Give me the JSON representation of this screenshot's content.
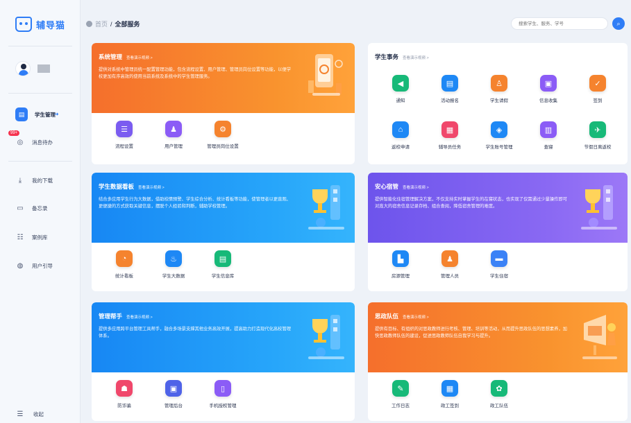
{
  "app": {
    "name": "辅导猫"
  },
  "colors": {
    "accent": "#2f7df6",
    "orange": "#f5832e",
    "blue": "#1f97f7",
    "purple": "#7b5ef0",
    "badge": "#f5334f"
  },
  "sidebar": {
    "items": [
      {
        "label": "学生管理",
        "icon": "student-icon",
        "active": true
      },
      {
        "label": "消息待办",
        "icon": "message-icon",
        "badge": "99+"
      },
      {
        "label": "我的下载",
        "icon": "download-icon"
      },
      {
        "label": "备忘录",
        "icon": "memo-icon"
      },
      {
        "label": "案例库",
        "icon": "case-library-icon"
      },
      {
        "label": "用户引导",
        "icon": "guide-icon"
      }
    ],
    "collapse_label": "收起"
  },
  "header": {
    "breadcrumb_home": "首页",
    "breadcrumb_sep": "/",
    "breadcrumb_current": "全部服务",
    "search_placeholder": "搜索学生、服务、学号"
  },
  "cards": {
    "system": {
      "title": "系统管理",
      "link": "查看演示视频 >",
      "desc_lines": [
        "提供对系统中管理员统一配置管理功能，包含流程设置、用户管理、管理员岗位设置等功能，以便学",
        "校更加有序高效的使用当前系统及系统中的学生管理服务。"
      ],
      "tiles": [
        {
          "label": "流程设置",
          "icon": "workflow-icon",
          "color": "#7a5cf0"
        },
        {
          "label": "用户管理",
          "icon": "users-icon",
          "color": "#8b5cf6"
        },
        {
          "label": "管理员岗位设置",
          "icon": "admin-post-icon",
          "color": "#f5832e"
        }
      ]
    },
    "student_affairs": {
      "title": "学生事务",
      "link": "查看演示视频 >",
      "tiles": [
        {
          "label": "通知",
          "icon": "speaker-icon",
          "color": "#17b978"
        },
        {
          "label": "活动报名",
          "icon": "signup-icon",
          "color": "#1e88f5"
        },
        {
          "label": "学生请假",
          "icon": "leave-icon",
          "color": "#f5832e"
        },
        {
          "label": "信息收集",
          "icon": "collect-icon",
          "color": "#8b5cf6"
        },
        {
          "label": "签到",
          "icon": "checkin-icon",
          "color": "#f5832e"
        },
        {
          "label": "返校申请",
          "icon": "return-icon",
          "color": "#1e88f5"
        },
        {
          "label": "辅导员任务",
          "icon": "task-icon",
          "color": "#f0476b"
        },
        {
          "label": "学生账号管理",
          "icon": "account-icon",
          "color": "#1e88f5"
        },
        {
          "label": "查寝",
          "icon": "dorm-check-icon",
          "color": "#8b5cf6"
        },
        {
          "label": "节假日离返校",
          "icon": "holiday-icon",
          "color": "#17b978"
        }
      ]
    },
    "data_board": {
      "title": "学生数据看板",
      "link": "查看演示视频 >",
      "desc_lines": [
        "结合多应用学生行为大数据，借助校情预警、学生综合分析、统计看板等功能，使管理者以更直观、",
        "更便捷的方式获取关键信息，摆脱个人经验和判断，辅助学校管理。"
      ],
      "tiles": [
        {
          "label": "统计看板",
          "icon": "stats-icon",
          "color": "#f5832e"
        },
        {
          "label": "学生大数据",
          "icon": "bigdata-icon",
          "color": "#1e88f5"
        },
        {
          "label": "学生信息库",
          "icon": "info-db-icon",
          "color": "#17b978"
        }
      ]
    },
    "dorm": {
      "title": "安心宿管",
      "link": "查看演示视频 >",
      "desc_lines": [
        "提供智能化住宿管理解决方案，不仅支持实时掌握学生的在寝状态，也实现了仅需通过少量操作即可",
        "对庞大的宿舍信息记录存档、组合查阅，降低宿舍管理的难度。"
      ],
      "tiles": [
        {
          "label": "房源管理",
          "icon": "room-icon",
          "color": "#1e88f5"
        },
        {
          "label": "管理人员",
          "icon": "staff-icon",
          "color": "#f5832e"
        },
        {
          "label": "学生住宿",
          "icon": "bed-icon",
          "color": "#3b82f6"
        }
      ]
    },
    "assistant": {
      "title": "管理帮手",
      "link": "查看演示视频 >",
      "desc_lines": [
        "提供多应用跨平台管理工具帮手，融合多场景支撑其他业务高效开展，提高助力打造现代化高校管理",
        "体系。"
      ],
      "tiles": [
        {
          "label": "防诈骗",
          "icon": "anti-fraud-icon",
          "color": "#f0476b"
        },
        {
          "label": "管理后台",
          "icon": "backend-icon",
          "color": "#4f63e8"
        },
        {
          "label": "手机授权管理",
          "icon": "phone-auth-icon",
          "color": "#8b5cf6"
        }
      ]
    },
    "team": {
      "title": "思政队伍",
      "link": "查看演示视频 >",
      "desc_lines": [
        "提供有目标、有组织的对思政教师进行考核、管理、培训等活动，从而提升思政队伍的思想素养，加",
        "快思政教师队伍的建设，促进思政教师队伍自我学习与提升。"
      ],
      "tiles": [
        {
          "label": "工作日志",
          "icon": "worklog-icon",
          "color": "#17b978"
        },
        {
          "label": "政工签到",
          "icon": "staff-checkin-icon",
          "color": "#1e88f5"
        },
        {
          "label": "政工队伍",
          "icon": "team-icon",
          "color": "#17b978"
        }
      ]
    }
  }
}
